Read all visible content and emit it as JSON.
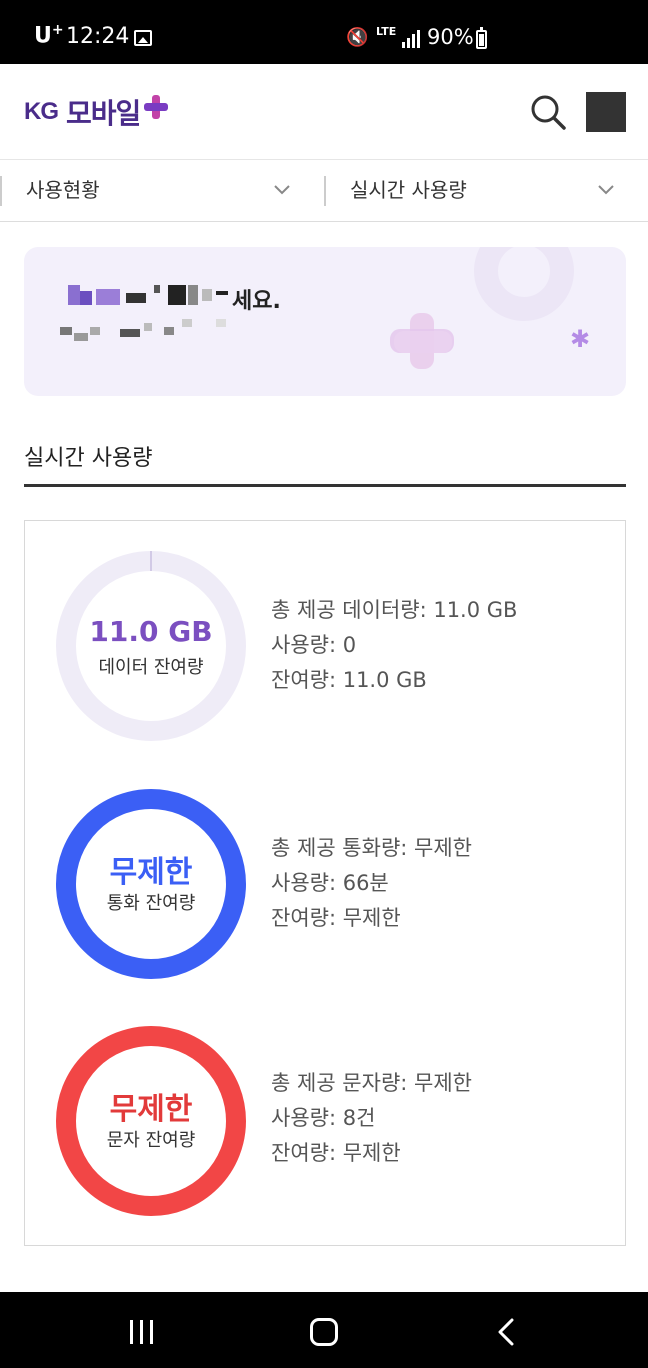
{
  "status_bar": {
    "carrier": "U",
    "carrier_plus": "+",
    "time": "12:24",
    "network": "LTE",
    "battery": "90%"
  },
  "header": {
    "logo_kg": "KG",
    "logo_text": "모바일",
    "icons": [
      "search-icon",
      "hamburger-menu-icon"
    ]
  },
  "selectors": {
    "category": "사용현황",
    "subcategory": "실시간 사용량"
  },
  "greeting": {
    "text": "세요."
  },
  "section": {
    "title": "실시간 사용량"
  },
  "usage": [
    {
      "ring_value": "11.0 GB",
      "ring_label": "데이터 잔여량",
      "color": "#7b4fc0",
      "ring_fill": 0,
      "total": "총 제공 데이터량: 11.0 GB",
      "used": "사용량: 0",
      "remaining": "잔여량: 11.0 GB"
    },
    {
      "ring_value": "무제한",
      "ring_label": "통화 잔여량",
      "color": "#3b5ff5",
      "ring_fill": 1,
      "total": "총 제공 통화량: 무제한",
      "used": "사용량: 66분",
      "remaining": "잔여량: 무제한"
    },
    {
      "ring_value": "무제한",
      "ring_label": "문자 잔여량",
      "color": "#f24646",
      "ring_fill": 1,
      "total": "총 제공 문자량: 무제한",
      "used": "사용량: 8건",
      "remaining": "잔여량: 무제한"
    }
  ],
  "colors": {
    "brand": "#4a2c8a",
    "data_ring_bg": "#efecf7",
    "call": "#3b5ff5",
    "sms": "#f24646",
    "card_bg": "#f3f0fb"
  }
}
